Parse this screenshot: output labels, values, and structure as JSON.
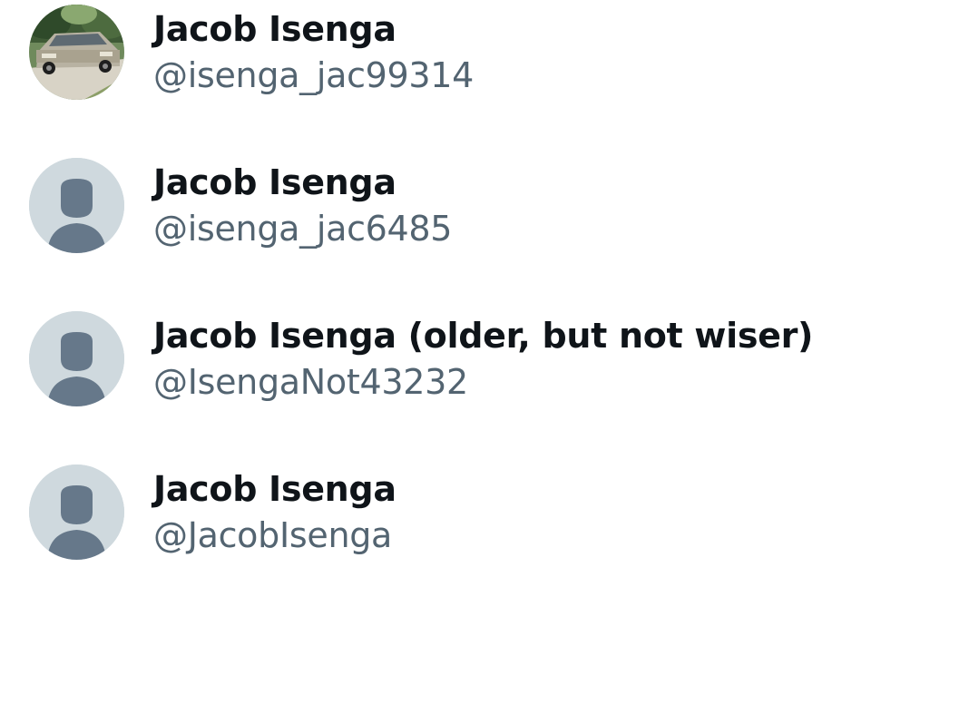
{
  "users": [
    {
      "name": "Jacob Isenga",
      "handle": "@isenga_jac99314",
      "avatar": "car-photo-avatar"
    },
    {
      "name": "Jacob Isenga",
      "handle": "@isenga_jac6485",
      "avatar": "default-profile-icon"
    },
    {
      "name": "Jacob Isenga (older, but not wiser)",
      "handle": "@IsengaNot43232",
      "avatar": "default-profile-icon"
    },
    {
      "name": "Jacob Isenga",
      "handle": "@JacobIsenga",
      "avatar": "default-profile-icon"
    }
  ],
  "colors": {
    "name_text": "#0f1419",
    "handle_text": "#536471",
    "default_avatar_bg": "#cfd9de",
    "default_avatar_figure": "#66788a"
  }
}
